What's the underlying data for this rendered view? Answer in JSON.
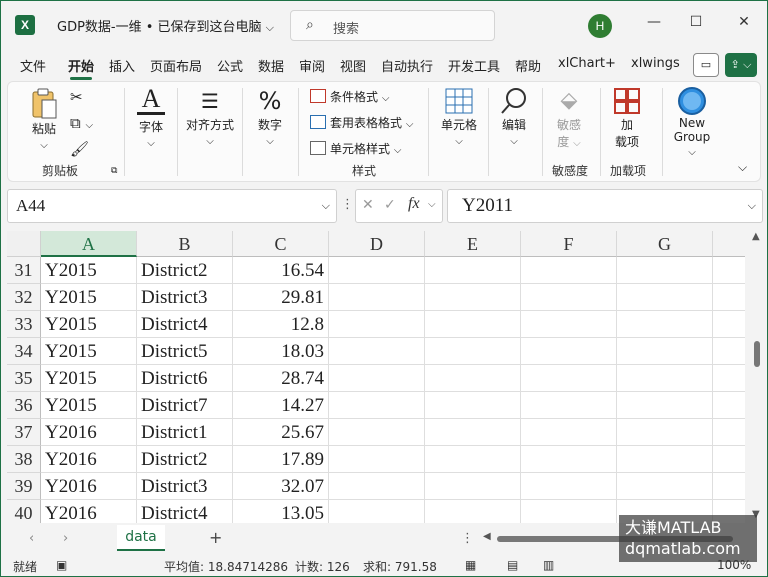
{
  "app": {
    "logo": "X",
    "title": "GDP数据-一维 • 已保存到这台电脑",
    "search_placeholder": "搜索",
    "user_initial": "H",
    "minimize": "—",
    "maximize": "☐",
    "close": "✕"
  },
  "tabs": [
    "文件",
    "开始",
    "插入",
    "页面布局",
    "公式",
    "数据",
    "审阅",
    "视图",
    "自动执行",
    "开发工具",
    "帮助",
    "xlChart+",
    "xlwings"
  ],
  "active_tab": "开始",
  "ribbon": {
    "paste": "粘贴",
    "clipboard_group": "剪贴板",
    "font": "字体",
    "align": "对齐方式",
    "number": "数字",
    "cond_format": "条件格式",
    "table_format": "套用表格格式",
    "cell_style": "单元格样式",
    "styles_group": "样式",
    "cells": "单元格",
    "edit": "编辑",
    "sensitivity_btn_line1": "敏感",
    "sensitivity_btn_line2": "度",
    "sensitivity_group": "敏感度",
    "addins_btn_line1": "加",
    "addins_btn_line2": "载项",
    "addins_group": "加载项",
    "new_group_line1": "New",
    "new_group_line2": "Group"
  },
  "formula_bar": {
    "name_box": "A44",
    "fx": "fx",
    "formula": "Y2011"
  },
  "grid": {
    "columns": [
      "A",
      "B",
      "C",
      "D",
      "E",
      "F",
      "G"
    ],
    "rows": [
      {
        "n": "31",
        "a": "Y2015",
        "b": "District2",
        "c": "16.54"
      },
      {
        "n": "32",
        "a": "Y2015",
        "b": "District3",
        "c": "29.81"
      },
      {
        "n": "33",
        "a": "Y2015",
        "b": "District4",
        "c": "12.8"
      },
      {
        "n": "34",
        "a": "Y2015",
        "b": "District5",
        "c": "18.03"
      },
      {
        "n": "35",
        "a": "Y2015",
        "b": "District6",
        "c": "28.74"
      },
      {
        "n": "36",
        "a": "Y2015",
        "b": "District7",
        "c": "14.27"
      },
      {
        "n": "37",
        "a": "Y2016",
        "b": "District1",
        "c": "25.67"
      },
      {
        "n": "38",
        "a": "Y2016",
        "b": "District2",
        "c": "17.89"
      },
      {
        "n": "39",
        "a": "Y2016",
        "b": "District3",
        "c": "32.07"
      },
      {
        "n": "40",
        "a": "Y2016",
        "b": "District4",
        "c": "13.05"
      }
    ]
  },
  "sheets": {
    "active": "data",
    "add": "+"
  },
  "status": {
    "ready": "就绪",
    "average": "平均值: 18.84714286",
    "count": "计数: 126",
    "sum": "求和: 791.58",
    "zoom": "100%"
  },
  "watermark": {
    "line1": "大谦MATLAB",
    "line2": "dqmatlab.com"
  },
  "colors": {
    "accent": "#1e7145"
  }
}
